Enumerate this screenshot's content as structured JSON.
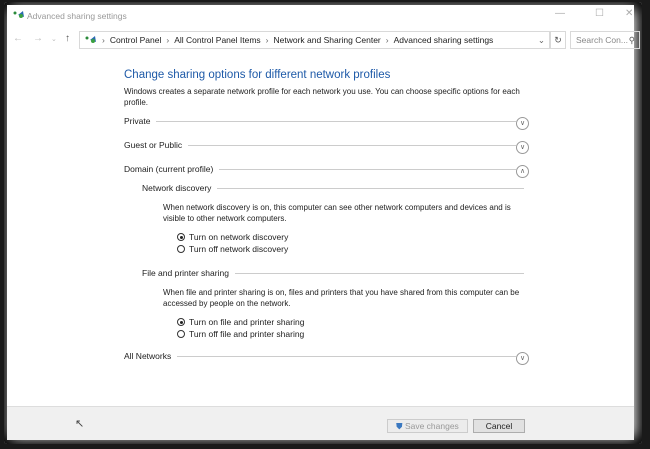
{
  "window": {
    "title": "Advanced sharing settings"
  },
  "breadcrumb": [
    "Control Panel",
    "All Control Panel Items",
    "Network and Sharing Center",
    "Advanced sharing settings"
  ],
  "search": {
    "placeholder": "Search Con..."
  },
  "main": {
    "heading": "Change sharing options for different network profiles",
    "description": "Windows creates a separate network profile for each network you use. You can choose specific options for each profile.",
    "profiles": {
      "private": "Private",
      "guest": "Guest or Public",
      "domain": "Domain (current profile)",
      "all": "All Networks"
    },
    "network_discovery": {
      "title": "Network discovery",
      "text": "When network discovery is on, this computer can see other network computers and devices and is visible to other network computers.",
      "on": "Turn on network discovery",
      "off": "Turn off network discovery",
      "selected": "on"
    },
    "file_sharing": {
      "title": "File and printer sharing",
      "text": "When file and printer sharing is on, files and printers that you have shared from this computer can be accessed by people on the network.",
      "on": "Turn on file and printer sharing",
      "off": "Turn off file and printer sharing",
      "selected": "on"
    }
  },
  "footer": {
    "save": "Save changes",
    "cancel": "Cancel"
  }
}
